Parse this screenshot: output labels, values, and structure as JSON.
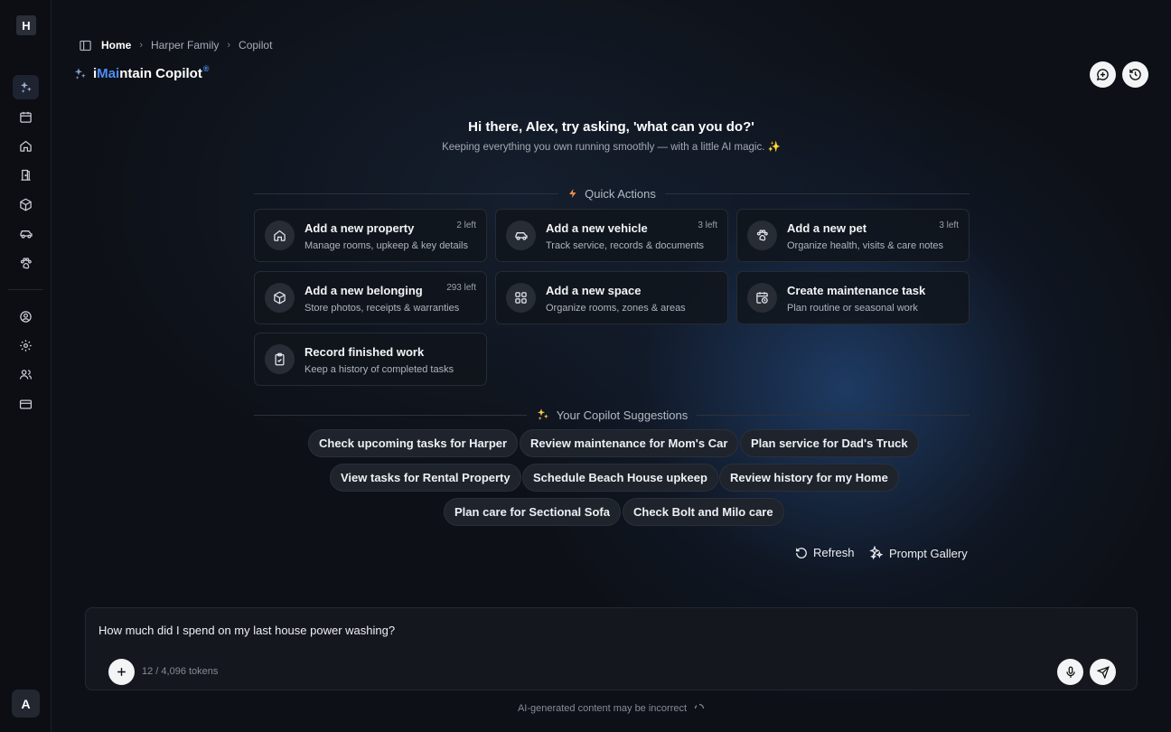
{
  "sidebar": {
    "workspace_initial": "H",
    "items": [
      {
        "name": "copilot-nav",
        "icon": "sparkles-icon",
        "active": true
      },
      {
        "name": "calendar-nav",
        "icon": "calendar-icon"
      },
      {
        "name": "home-nav",
        "icon": "home-icon"
      },
      {
        "name": "spaces-nav",
        "icon": "door-icon"
      },
      {
        "name": "belongings-nav",
        "icon": "box-icon"
      },
      {
        "name": "vehicles-nav",
        "icon": "car-icon"
      },
      {
        "name": "pets-nav",
        "icon": "paw-icon"
      },
      {
        "name": "profile-nav",
        "icon": "user-circle-icon"
      },
      {
        "name": "settings-nav",
        "icon": "gear-icon"
      },
      {
        "name": "members-nav",
        "icon": "users-icon"
      },
      {
        "name": "billing-nav",
        "icon": "credit-card-icon"
      }
    ],
    "user_initial": "A"
  },
  "breadcrumb": {
    "home": "Home",
    "family": "Harper Family",
    "current": "Copilot"
  },
  "app_title": {
    "prefix": "i",
    "highlight": "Mai",
    "suffix": "ntain Copilot",
    "mark": "®"
  },
  "greeting": {
    "title": "Hi there, Alex, try asking, 'what can you do?'",
    "subtitle": "Keeping everything you own running smoothly — with a little AI magic. ✨"
  },
  "quick_actions": {
    "label": "Quick Actions",
    "cards": [
      {
        "title": "Add a new property",
        "desc": "Manage rooms, upkeep & key details",
        "left": "2 left",
        "icon": "home-icon"
      },
      {
        "title": "Add a new vehicle",
        "desc": "Track service, records & documents",
        "left": "3 left",
        "icon": "car-icon"
      },
      {
        "title": "Add a new pet",
        "desc": "Organize health, visits & care notes",
        "left": "3 left",
        "icon": "paw-icon"
      },
      {
        "title": "Add a new belonging",
        "desc": "Store photos, receipts & warranties",
        "left": "293 left",
        "icon": "box-icon"
      },
      {
        "title": "Add a new space",
        "desc": "Organize rooms, zones & areas",
        "left": "",
        "icon": "grid-icon"
      },
      {
        "title": "Create maintenance task",
        "desc": "Plan routine or seasonal work",
        "left": "",
        "icon": "calendar-clock-icon"
      },
      {
        "title": "Record finished work",
        "desc": "Keep a history of completed tasks",
        "left": "",
        "icon": "clipboard-check-icon"
      }
    ]
  },
  "suggestions": {
    "label": "Your Copilot Suggestions",
    "chips": [
      "Check upcoming tasks for Harper",
      "Review maintenance for Mom's Car",
      "Plan service for Dad's Truck",
      "View tasks for Rental Property",
      "Schedule Beach House upkeep",
      "Review history for my Home",
      "Plan care for Sectional Sofa",
      "Check Bolt and Milo care"
    ],
    "refresh": "Refresh",
    "gallery": "Prompt Gallery"
  },
  "composer": {
    "value": "How much did I spend on my last house power washing?",
    "tokens": "12 / 4,096 tokens"
  },
  "disclaimer": "AI-generated content may be incorrect",
  "colors": {
    "accent": "#4f8df7",
    "bolt": "#f08a4b",
    "sparkle": "#f5c451"
  }
}
